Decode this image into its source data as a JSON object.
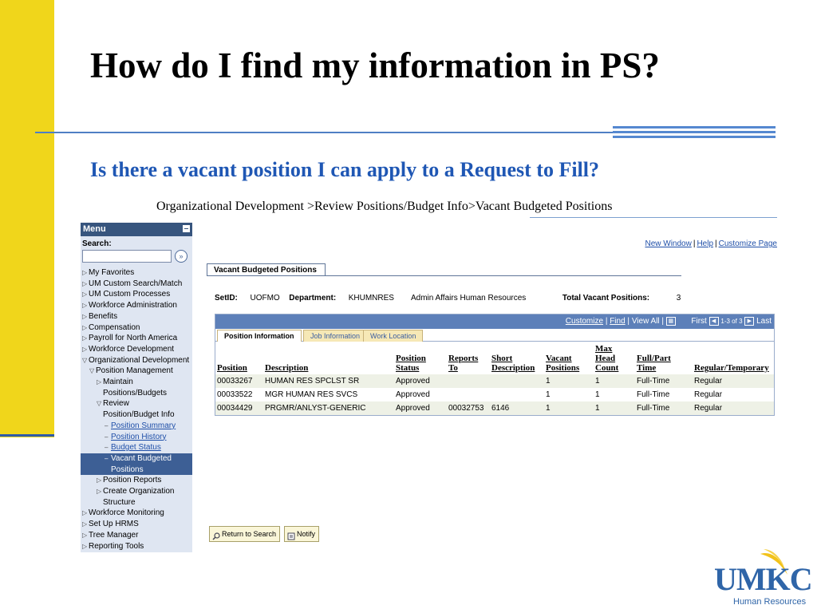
{
  "slide": {
    "title": "How do I find my information in PS?",
    "subtitle": "Is there a vacant position I can apply to a Request to Fill?",
    "nav_path": "Organizational Development >Review Positions/Budget Info>Vacant Budgeted Positions"
  },
  "menu": {
    "header": "Menu",
    "search_label": "Search:",
    "search_value": "",
    "items": [
      {
        "label": "My Favorites"
      },
      {
        "label": "UM Custom Search/Match"
      },
      {
        "label": "UM Custom Processes"
      },
      {
        "label": "Workforce Administration"
      },
      {
        "label": "Benefits"
      },
      {
        "label": "Compensation"
      },
      {
        "label": "Payroll for North America"
      },
      {
        "label": "Workforce Development"
      },
      {
        "label": "Organizational Development"
      },
      {
        "label": "Position Management"
      },
      {
        "label": "Maintain Positions/Budgets"
      },
      {
        "label": "Review Position/Budget Info"
      },
      {
        "label": "Position Summary"
      },
      {
        "label": "Position History"
      },
      {
        "label": "Budget Status"
      },
      {
        "label": "Vacant Budgeted Positions"
      },
      {
        "label": "Position Reports"
      },
      {
        "label": "Create Organization Structure"
      },
      {
        "label": "Workforce Monitoring"
      },
      {
        "label": "Set Up HRMS"
      },
      {
        "label": "Tree Manager"
      },
      {
        "label": "Reporting Tools"
      }
    ]
  },
  "content": {
    "top_links": {
      "new_window": "New Window",
      "help": "Help",
      "customize_page": "Customize Page"
    },
    "page_tab": "Vacant Budgeted Positions",
    "setid_label": "SetID:",
    "setid_value": "UOFMO",
    "department_label": "Department:",
    "department_value": "KHUMNRES",
    "department_desc": "Admin Affairs Human Resources",
    "total_label": "Total Vacant Positions:",
    "total_value": "3",
    "grid_nav": {
      "customize": "Customize",
      "find": "Find",
      "view_all": "View All",
      "first": "First",
      "range": "1-3 of 3",
      "last": "Last"
    },
    "grid_tabs": [
      "Position Information",
      "Job Information",
      "Work Location"
    ],
    "columns": [
      "Position",
      "Description",
      "Position Status",
      "Reports To",
      "Short Description",
      "Vacant Positions",
      "Max Head Count",
      "Full/Part Time",
      "Regular/Temporary"
    ],
    "rows": [
      [
        "00033267",
        "HUMAN RES SPCLST SR",
        "Approved",
        "",
        "",
        "1",
        "1",
        "Full-Time",
        "Regular"
      ],
      [
        "00033522",
        "MGR HUMAN RES SVCS",
        "Approved",
        "",
        "",
        "1",
        "1",
        "Full-Time",
        "Regular"
      ],
      [
        "00034429",
        "PRGMR/ANLYST-GENERIC",
        "Approved",
        "00032753",
        "6146",
        "1",
        "1",
        "Full-Time",
        "Regular"
      ]
    ],
    "buttons": {
      "return": "Return to Search",
      "notify": "Notify"
    }
  },
  "logo": {
    "text": "UMKC",
    "sub": "Human Resources"
  },
  "colors": {
    "accent_yellow": "#f0d61b",
    "title_blue": "#1f57b4",
    "menu_header": "#37557e",
    "grid_bar": "#5d80b9"
  }
}
